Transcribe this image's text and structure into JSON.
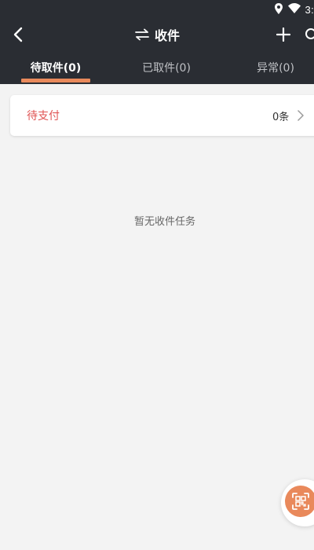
{
  "status_bar": {
    "time": "3:",
    "icons": [
      "location-icon",
      "wifi-icon"
    ]
  },
  "header": {
    "title": "收件",
    "title_icon": "swap-arrows-icon",
    "back_icon": "back-chevron-icon",
    "add_icon": "plus-icon",
    "search_icon": "search-icon"
  },
  "tabs": [
    {
      "label": "待取件(0)",
      "active": true
    },
    {
      "label": "已取件(0)",
      "active": false
    },
    {
      "label": "异常(0)",
      "active": false
    }
  ],
  "pending_payment": {
    "label": "待支付",
    "count": "0条"
  },
  "empty_state": {
    "message": "暂无收件任务"
  },
  "fab": {
    "icon": "scan-qr-icon"
  },
  "colors": {
    "header_bg": "#2a2d33",
    "accent": "#e98a5c",
    "page_bg": "#f3f3f3",
    "alert_text": "#e05454"
  }
}
